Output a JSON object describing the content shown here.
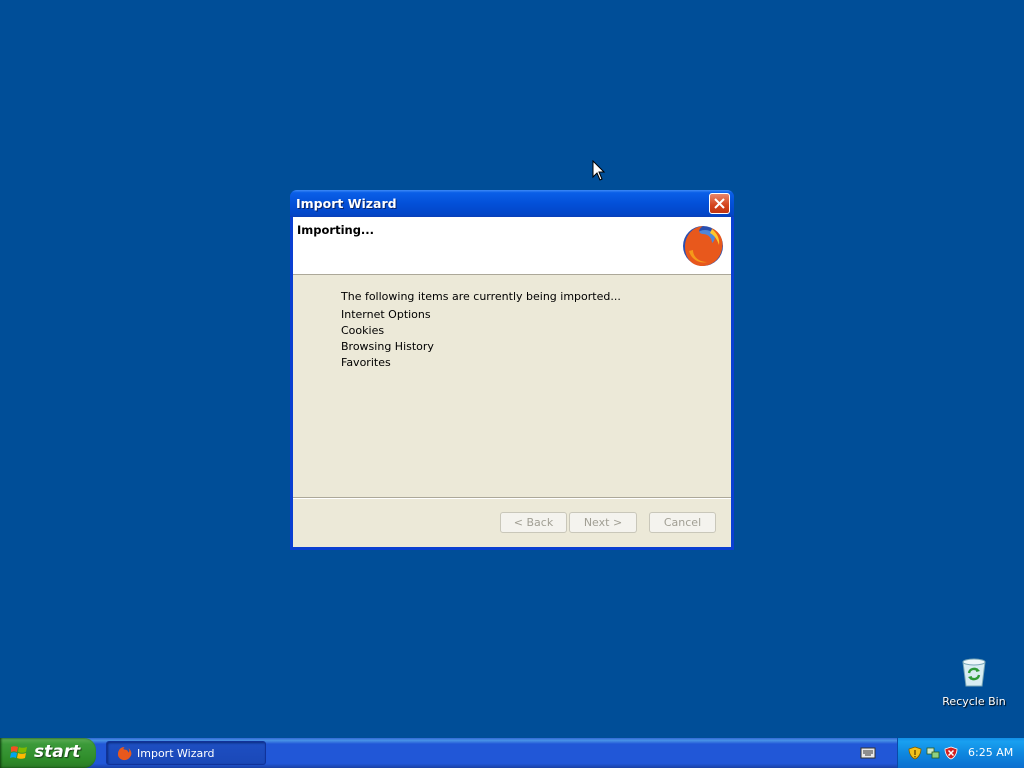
{
  "window": {
    "title": "Import Wizard",
    "heading": "Importing...",
    "intro": "The following items are currently being imported...",
    "items": [
      "Internet Options",
      "Cookies",
      "Browsing History",
      "Favorites"
    ],
    "buttons": {
      "back": "< Back",
      "next": "Next >",
      "cancel": "Cancel"
    }
  },
  "desktop": {
    "recycle_bin_label": "Recycle Bin"
  },
  "taskbar": {
    "start_label": "start",
    "task_label": "Import Wizard",
    "clock": "6:25 AM"
  },
  "icons": [
    "close-icon",
    "firefox-logo-icon",
    "recycle-bin-icon",
    "windows-flag-icon",
    "keyboard-icon",
    "security-shield-icon",
    "network-icon",
    "security-alert-icon",
    "mouse-pointer-icon"
  ],
  "colors": {
    "desktop": "#004e98",
    "titlebar": "#0350d8",
    "close": "#d4431c",
    "dialog": "#ece9d8"
  }
}
